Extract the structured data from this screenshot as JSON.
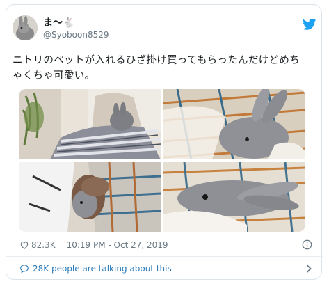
{
  "user": {
    "display_name": "ま〜🐇",
    "handle": "@Syoboon8529",
    "avatar_icon": "rabbit-avatar"
  },
  "tweet": {
    "text": "ニトリのペットが入れるひざ掛け買ってもらったんだけどめちゃくちゃ可愛い。"
  },
  "media": [
    {
      "icon": "photo-person-with-blanket-and-rabbit"
    },
    {
      "icon": "photo-rabbit-in-blanket"
    },
    {
      "icon": "photo-rabbit-held-in-lap"
    },
    {
      "icon": "photo-rabbit-closeup-in-blanket"
    }
  ],
  "meta": {
    "likes": "82.3K",
    "timestamp": "10:19 PM - Oct 27, 2019"
  },
  "footer": {
    "talking": "28K people are talking about this"
  },
  "colors": {
    "twitter_blue": "#1da1f2",
    "link_blue": "#2b7bb9",
    "muted_text": "#697882",
    "border": "#dce4ea"
  }
}
